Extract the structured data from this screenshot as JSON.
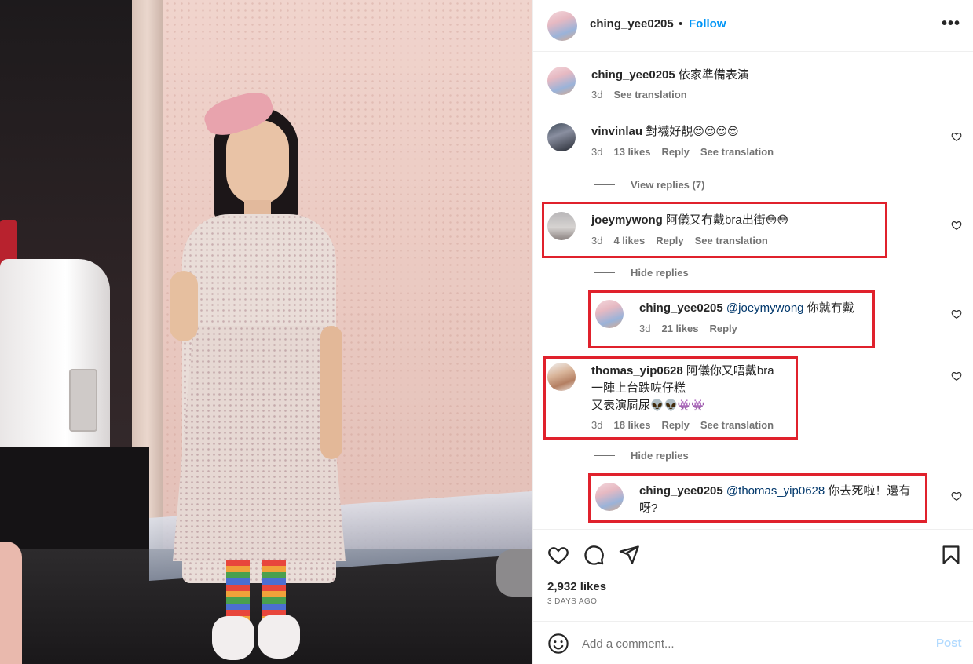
{
  "post": {
    "author": "ching_yee0205",
    "separator": "•",
    "follow_label": "Follow",
    "more_label": "•••"
  },
  "caption": {
    "user": "ching_yee0205",
    "text": "依家準備表演",
    "time": "3d",
    "translate": "See translation"
  },
  "comments": [
    {
      "user": "vinvinlau",
      "text": "對襪好靚",
      "emoji": "😍😍😍😍",
      "time": "3d",
      "likes": "13 likes",
      "reply": "Reply",
      "translate": "See translation",
      "replies_toggle": "View replies (7)"
    },
    {
      "user": "joeymywong",
      "text": "阿儀又冇戴bra出街",
      "emoji": "😳😳",
      "time": "3d",
      "likes": "4 likes",
      "reply": "Reply",
      "translate": "See translation",
      "replies_toggle": "Hide replies",
      "reply_item": {
        "user": "ching_yee0205",
        "mention": "@joeymywong",
        "text": "你就冇戴",
        "time": "3d",
        "likes": "21 likes",
        "reply": "Reply"
      }
    },
    {
      "user": "thomas_yip0628",
      "text_line1": "阿儀你又唔戴bra",
      "text_line2": "一陣上台跌咗仔糕",
      "text_line3": "又表演屙尿",
      "emoji": "👽👽👾👾",
      "time": "3d",
      "likes": "18 likes",
      "reply": "Reply",
      "translate": "See translation",
      "replies_toggle": "Hide replies",
      "reply_item": {
        "user": "ching_yee0205",
        "mention": "@thomas_yip0628",
        "text_line1": "你去死啦！邊有",
        "text_line2": "呀?"
      }
    }
  ],
  "actions": {
    "likes": "2,932 likes",
    "posted": "3 DAYS AGO"
  },
  "add_comment": {
    "placeholder": "Add a comment...",
    "post_label": "Post"
  },
  "colors": {
    "accent": "#0095f6",
    "highlight_box": "#e0212c",
    "mention": "#00376b",
    "muted": "#737373"
  },
  "icons": [
    "heart-icon",
    "comment-icon",
    "share-icon",
    "bookmark-icon",
    "emoji-icon",
    "more-icon"
  ]
}
